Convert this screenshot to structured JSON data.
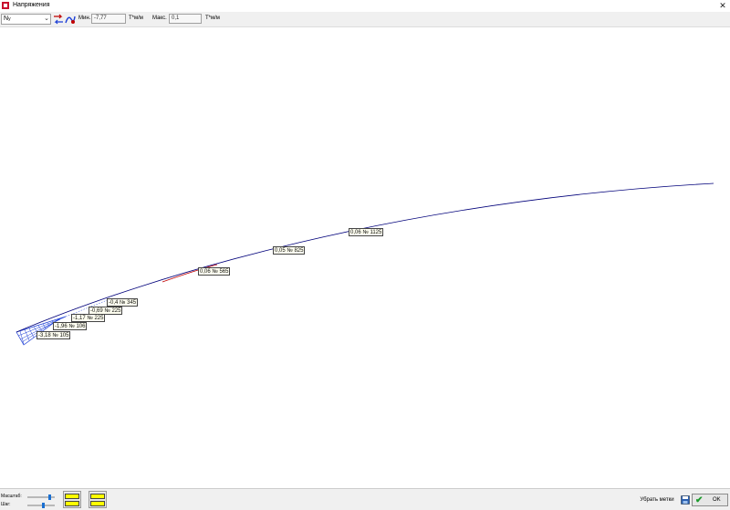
{
  "window": {
    "title": "Напряжения",
    "close_glyph": "✕"
  },
  "toolbar": {
    "component_main": "N",
    "component_sub": "y",
    "min_label": "Мин.",
    "min_value": "-7,77",
    "min_unit": "Т*м/м",
    "max_label": "Макс.",
    "max_value": "0,1",
    "max_unit": "Т*м/м"
  },
  "labels": [
    {
      "text": "0,06 № 1125"
    },
    {
      "text": "0,05 № 825"
    },
    {
      "text": "0,06 № 565"
    },
    {
      "text": "-0,4 № 345"
    },
    {
      "text": "-0,69 № 225"
    },
    {
      "text": "-1,17 № 225"
    },
    {
      "text": "-1,96 № 106"
    },
    {
      "text": "-3,18 № 105"
    }
  ],
  "bottom": {
    "scale_label": "Масштаб:",
    "step_label": "Шаг:",
    "scale_level": 0.85,
    "step_level": 0.6,
    "hide_labels": "Убрать метки",
    "ok": "OK"
  },
  "colors": {
    "line": "#00007a",
    "line_red": "#c00000",
    "hatch": "#1a3cd6",
    "legend_fill": "#ffff00"
  }
}
